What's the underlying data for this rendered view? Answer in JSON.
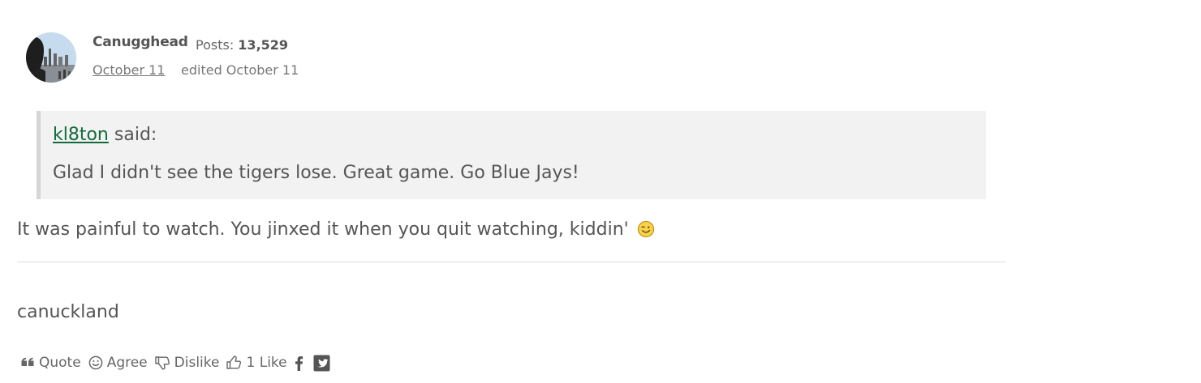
{
  "post": {
    "author": "Canugghead",
    "posts_label": "Posts:",
    "posts_count": "13,529",
    "date": "October 11",
    "edited": "edited October 11"
  },
  "quote": {
    "user": "kl8ton",
    "said": "said:",
    "text": "Glad I didn't see the tigers lose. Great game. Go Blue Jays!"
  },
  "body": {
    "text": "It was painful to watch. You jinxed it when you quit watching, kiddin'",
    "emoji": "winking-face-icon"
  },
  "signature": "canuckland",
  "actions": {
    "quote": "Quote",
    "agree": "Agree",
    "dislike": "Dislike",
    "like_count": "1",
    "like": "Like"
  },
  "colors": {
    "link_green": "#146a3e",
    "text": "#555555",
    "quote_bg": "#f2f2f2"
  }
}
